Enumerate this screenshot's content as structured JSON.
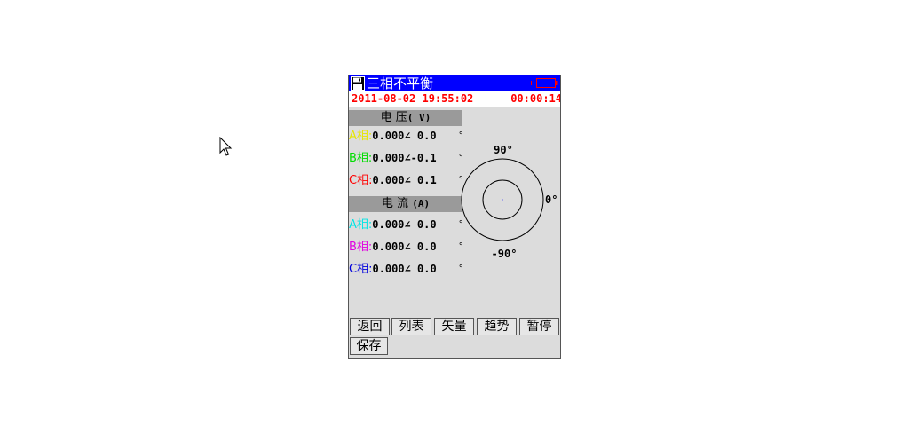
{
  "window": {
    "title": "三相不平衡",
    "datetime": "2011-08-02 19:55:02",
    "elapsed": "00:00:14"
  },
  "colors": {
    "titlebar": "#0000ff",
    "status_text": "#ff0000",
    "phase_a_voltage": "#e6e600",
    "phase_b_voltage": "#00dd00",
    "phase_c_voltage": "#ff0000",
    "phase_a_current": "#00e5e5",
    "phase_b_current": "#e000e0",
    "phase_c_current": "#0000dd"
  },
  "voltage": {
    "heading": "电 压",
    "unit": "( V)",
    "rows": [
      {
        "label": "A相:",
        "magnitude": "0.000",
        "angle": " 0.0",
        "deg": "°"
      },
      {
        "label": "B相:",
        "magnitude": "0.000",
        "angle": "-0.1",
        "deg": "°"
      },
      {
        "label": "C相:",
        "magnitude": "0.000",
        "angle": " 0.1",
        "deg": "°"
      }
    ]
  },
  "current": {
    "heading": "电 流",
    "unit": "(A)",
    "rows": [
      {
        "label": "A相:",
        "magnitude": "0.000",
        "angle": " 0.0",
        "deg": "°"
      },
      {
        "label": "B相:",
        "magnitude": "0.000",
        "angle": " 0.0",
        "deg": "°"
      },
      {
        "label": "C相:",
        "magnitude": "0.000",
        "angle": " 0.0",
        "deg": "°"
      }
    ]
  },
  "phasor": {
    "top_label": "90°",
    "right_label": "0°",
    "bottom_label": "-90°"
  },
  "buttons": {
    "back": "返回",
    "list": "列表",
    "vector": "矢量",
    "trend": "趋势",
    "pause": "暂停",
    "save": "保存"
  },
  "angle_symbol": "∠"
}
